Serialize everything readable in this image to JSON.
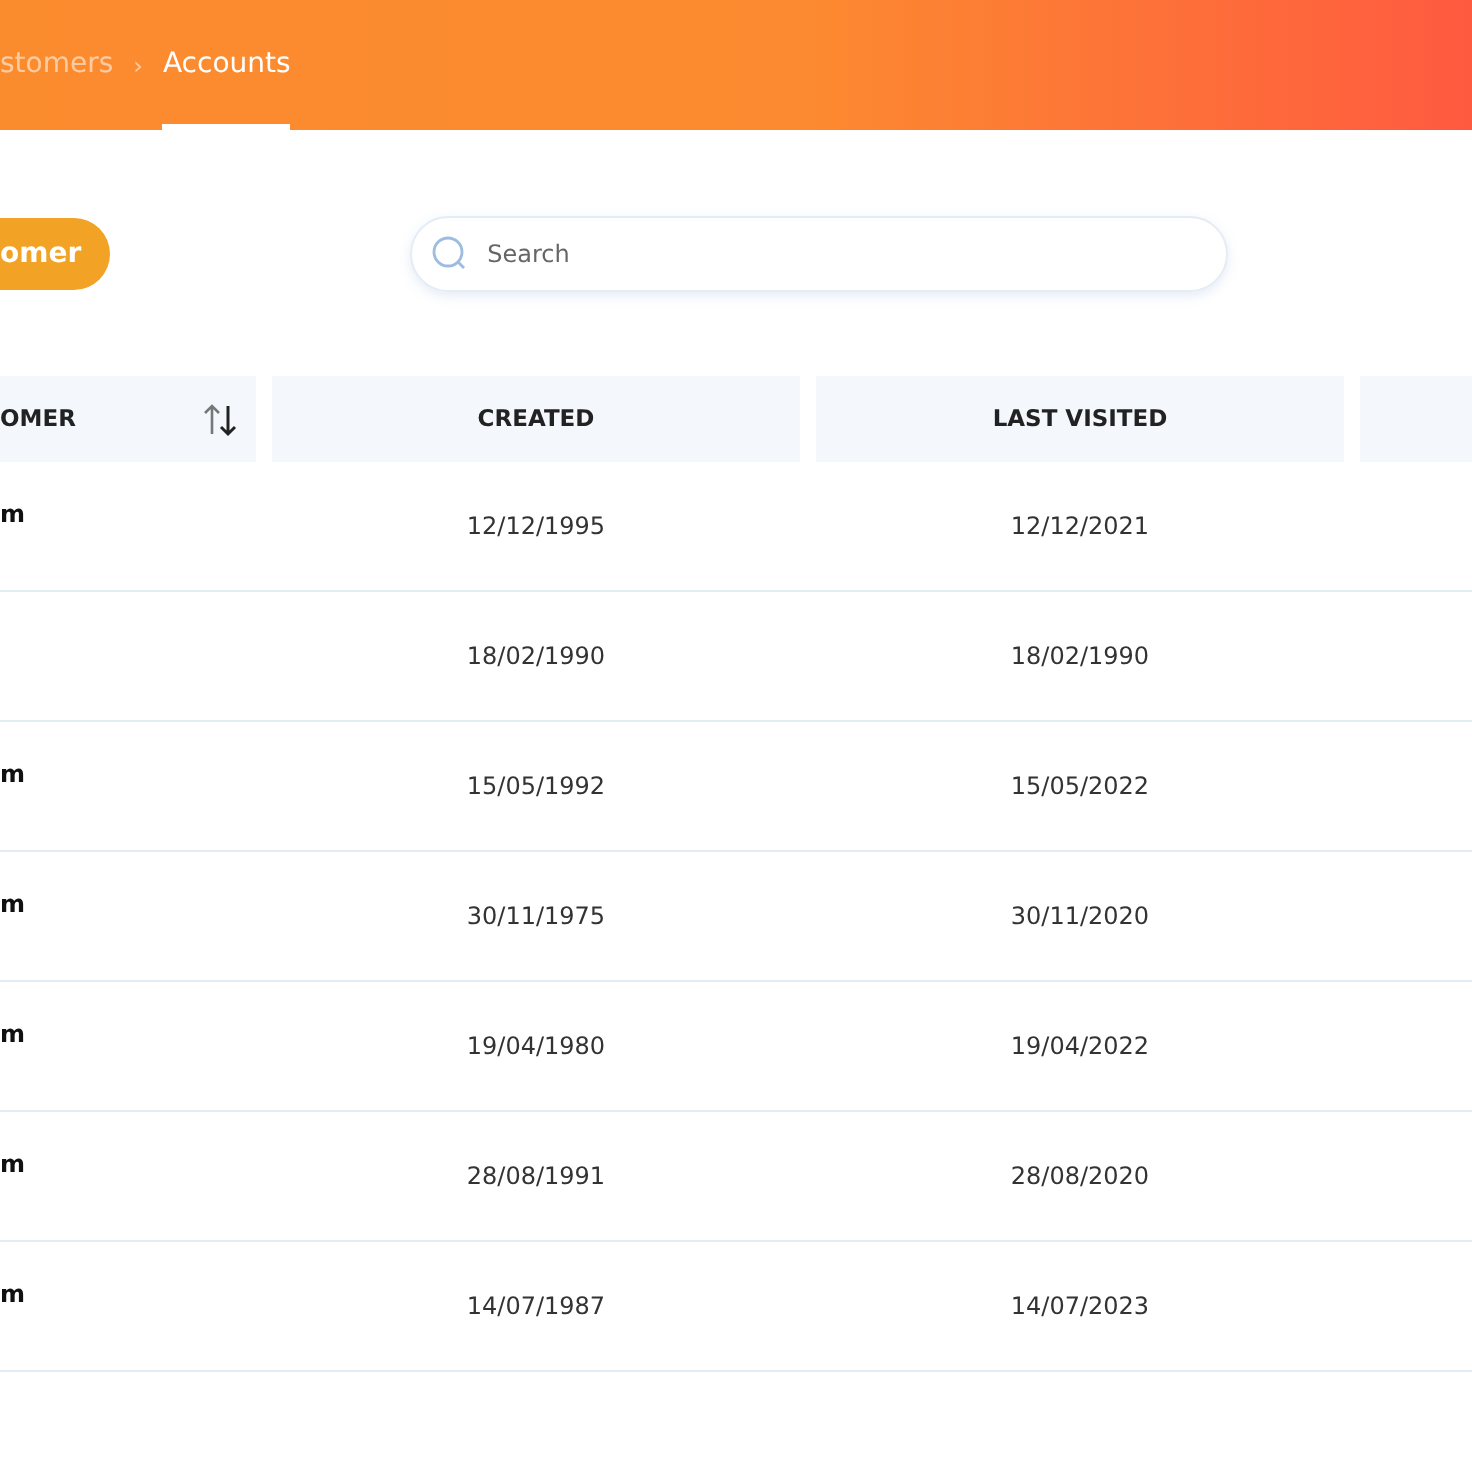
{
  "breadcrumb": {
    "separator": "›",
    "items": [
      {
        "label": "stomers",
        "selected": false
      },
      {
        "label": "Accounts",
        "selected": true
      }
    ]
  },
  "add_button": {
    "label": "omer"
  },
  "search": {
    "placeholder": "Search"
  },
  "table": {
    "columns": [
      {
        "label": "OMER",
        "sortable": true
      },
      {
        "label": "CREATED",
        "sortable": false
      },
      {
        "label": "LAST VISITED",
        "sortable": false
      }
    ],
    "rows": [
      {
        "customer": "m",
        "created": "12/12/1995",
        "last_visited": "12/12/2021"
      },
      {
        "created": "18/02/1990",
        "last_visited": "18/02/1990"
      },
      {
        "customer": "m",
        "created": "15/05/1992",
        "last_visited": "15/05/2022"
      },
      {
        "customer": "m",
        "created": "30/11/1975",
        "last_visited": "30/11/2020"
      },
      {
        "customer": "m",
        "created": "19/04/1980",
        "last_visited": "19/04/2022"
      },
      {
        "customer": "m",
        "created": "28/08/1991",
        "last_visited": "28/08/2020"
      },
      {
        "customer": "m",
        "created": "14/07/1987",
        "last_visited": "14/07/2023"
      }
    ]
  }
}
